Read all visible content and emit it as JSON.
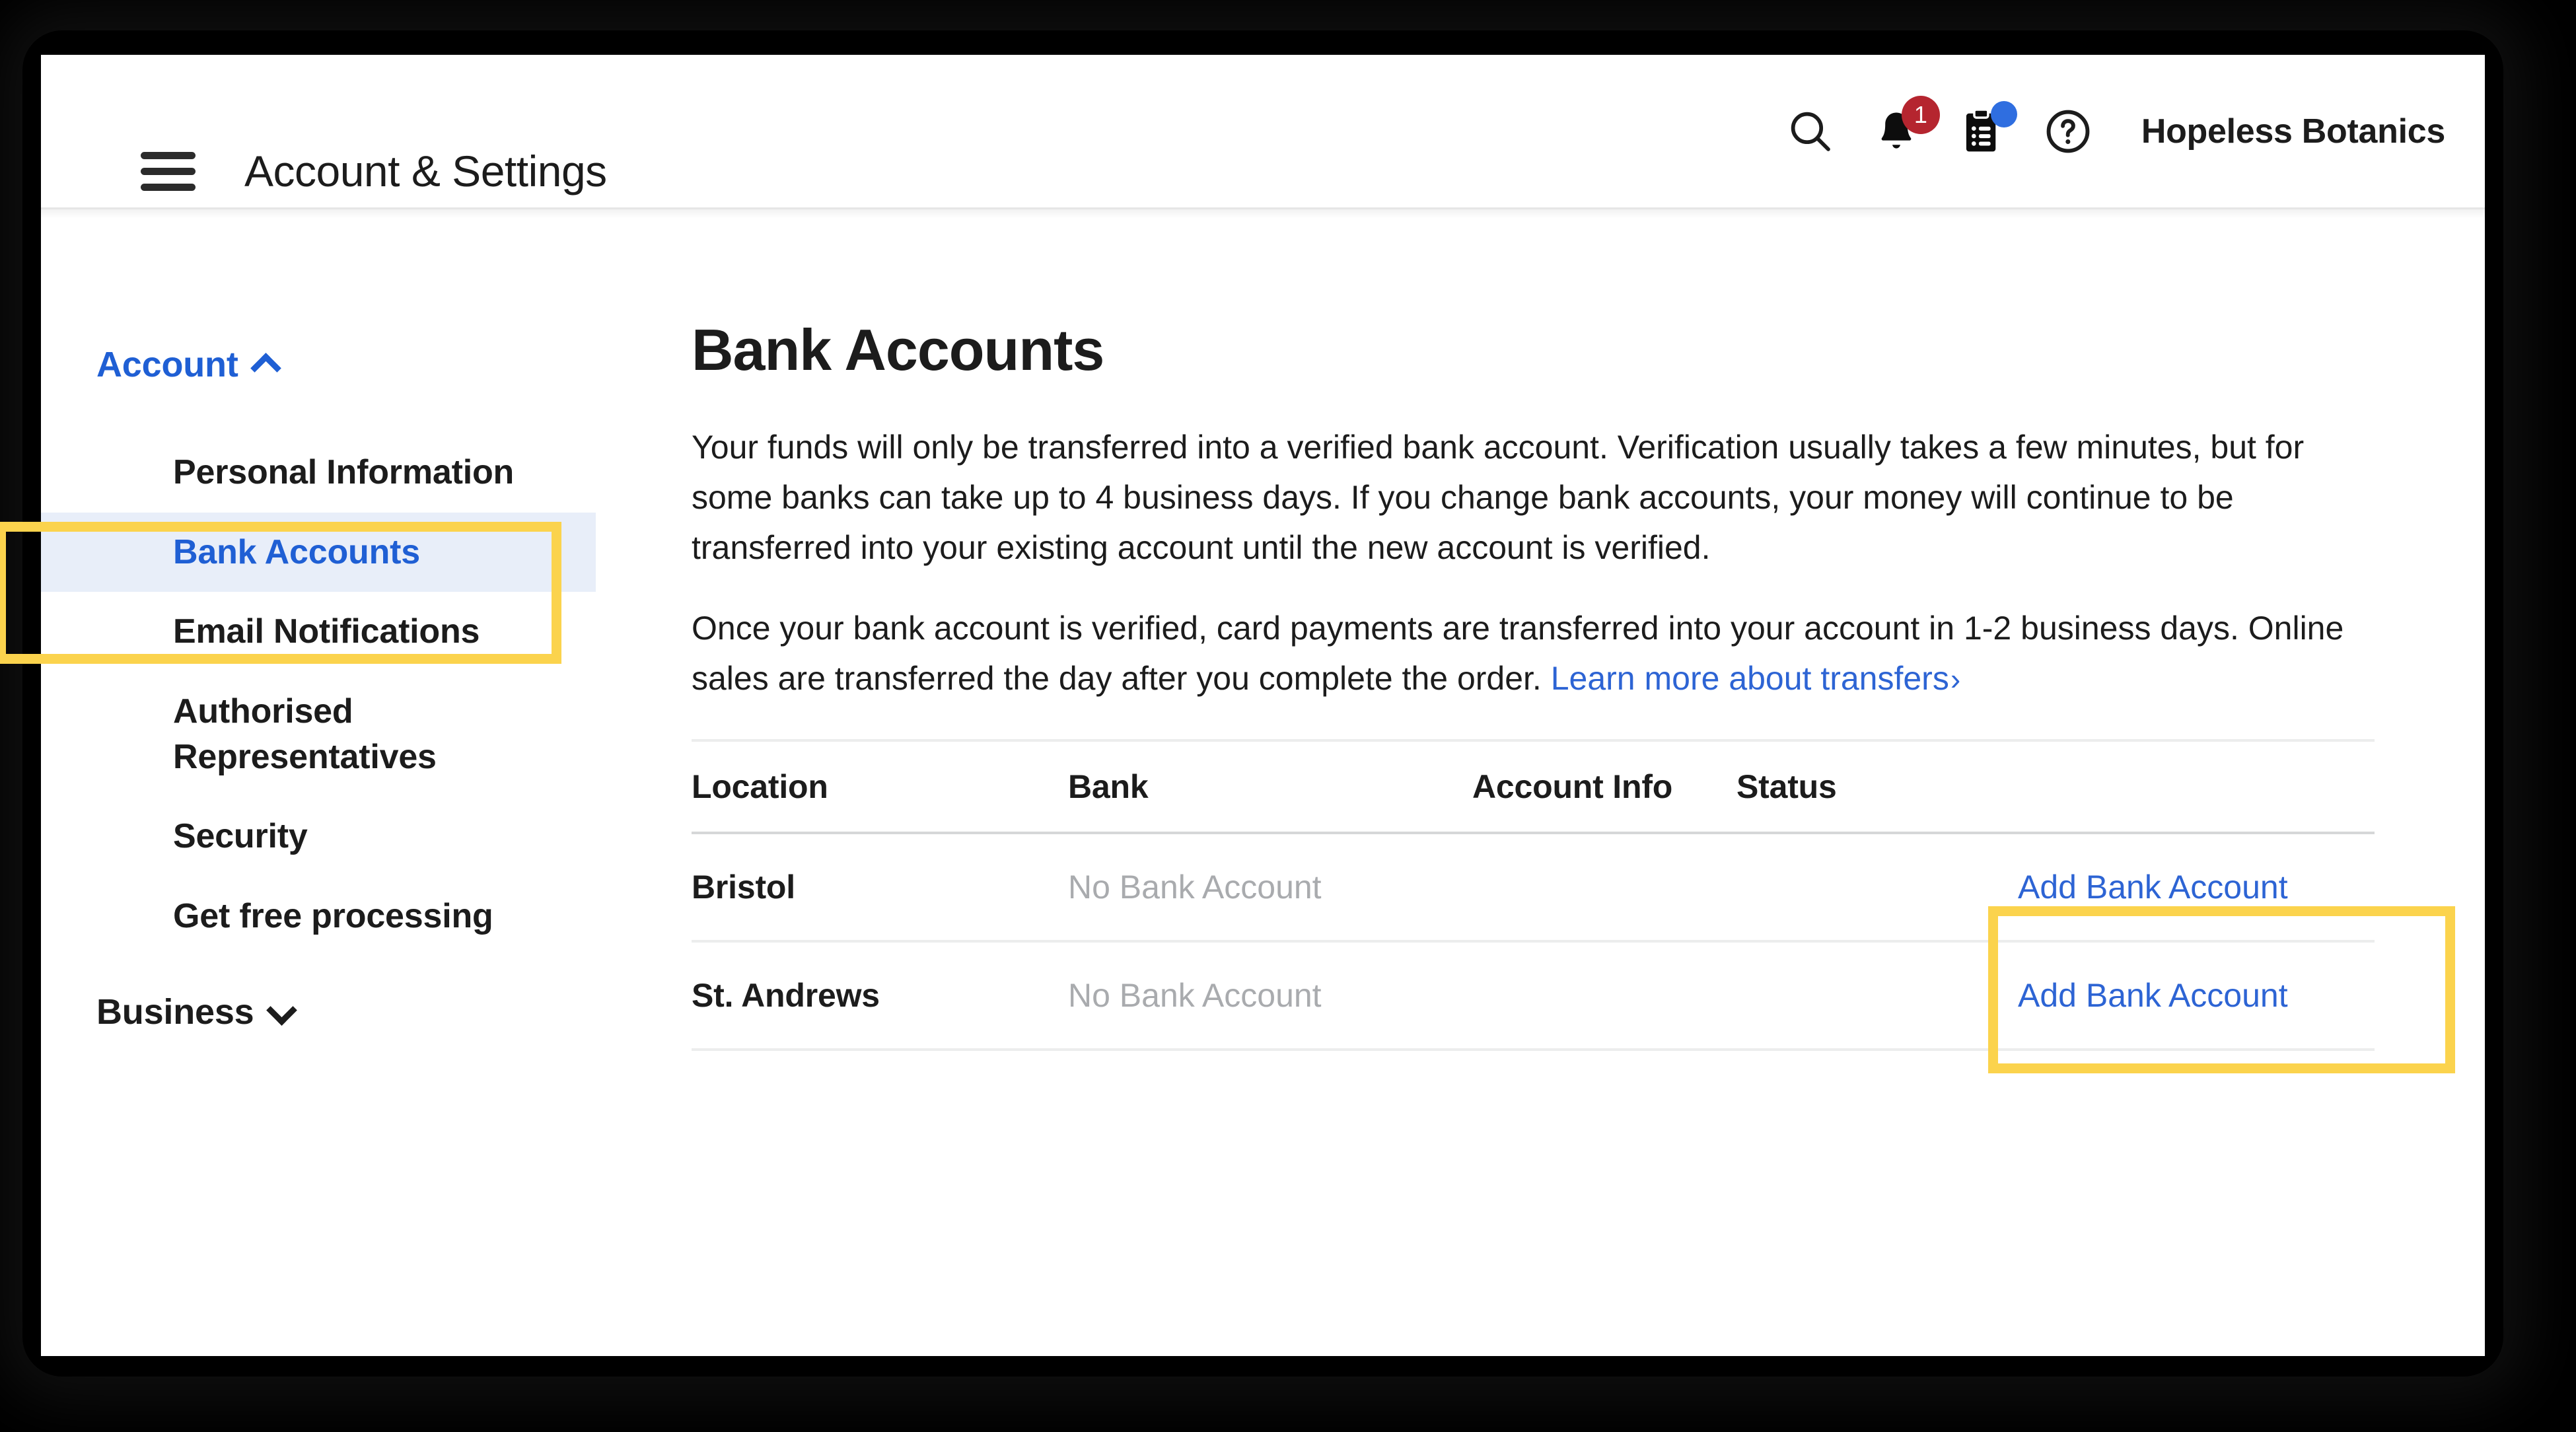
{
  "header": {
    "menu_icon": "hamburger-icon",
    "title": "Account & Settings",
    "search_icon": "search-icon",
    "notifications_icon": "bell-icon",
    "notifications_badge": "1",
    "tasks_icon": "clipboard-icon",
    "tasks_badge_dot": "",
    "help_icon": "question-circle-icon",
    "user_name": "Hopeless Botanics"
  },
  "sidebar": {
    "groups": [
      {
        "label": "Account",
        "expanded": true,
        "chevron": "chevron-up-icon",
        "items": [
          {
            "label": "Personal Information",
            "active": false
          },
          {
            "label": "Bank Accounts",
            "active": true
          },
          {
            "label": "Email Notifications",
            "active": false
          },
          {
            "label": "Authorised Representatives",
            "active": false
          },
          {
            "label": "Security",
            "active": false
          },
          {
            "label": "Get free processing",
            "active": false
          }
        ]
      },
      {
        "label": "Business",
        "expanded": false,
        "chevron": "chevron-down-icon",
        "items": []
      }
    ]
  },
  "main": {
    "title": "Bank Accounts",
    "paragraph_1": "Your funds will only be transferred into a verified bank account. Verification usually takes a few minutes, but for some banks can take up to 4 business days. If you change bank accounts, your money will continue to be transferred into your existing account until the new account is verified.",
    "paragraph_2_text": "Once your bank account is verified, card payments are transferred into your account in 1-2 business days. Online sales are transferred the day after you complete the order.",
    "learn_more_link": "Learn more about transfers",
    "learn_more_arrow": "›",
    "table": {
      "columns": [
        "Location",
        "Bank",
        "Account Info",
        "Status"
      ],
      "rows": [
        {
          "location": "Bristol",
          "bank": "No Bank Account",
          "account_info": "",
          "status": "",
          "action": "Add Bank Account"
        },
        {
          "location": "St. Andrews",
          "bank": "No Bank Account",
          "account_info": "",
          "status": "",
          "action": "Add Bank Account"
        }
      ]
    }
  },
  "annotations": {
    "highlight_color": "#fbd34d",
    "targets": [
      "sidebar-item-bank-accounts",
      "add-bank-account-row-1"
    ]
  },
  "colors": {
    "accent_blue": "#2d64d4",
    "active_bg": "#e8eef9",
    "badge_red": "#b5252f",
    "badge_blue": "#2f6ee0",
    "muted_text": "#a9abae",
    "highlight_yellow": "#fbd34d",
    "page_bg": "#000000"
  }
}
